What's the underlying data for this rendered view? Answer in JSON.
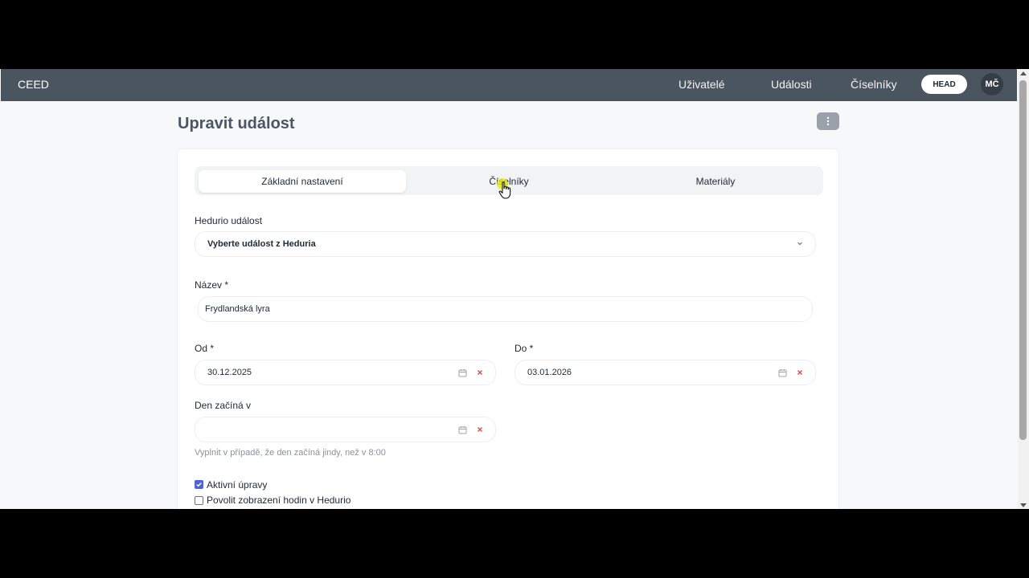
{
  "nav": {
    "brand": "CEED",
    "links": [
      "Uživatelé",
      "Události",
      "Číselníky"
    ],
    "head_badge": "HEAD",
    "avatar_initials": "MČ"
  },
  "page": {
    "title": "Upravit událost"
  },
  "tabs": [
    {
      "label": "Základní nastavení",
      "active": true
    },
    {
      "label": "Číselníky",
      "active": false
    },
    {
      "label": "Materiály",
      "active": false
    }
  ],
  "form": {
    "hedurio_label": "Hedurio událost",
    "hedurio_value": "Vyberte událost z Heduria",
    "name_label": "Název *",
    "name_value": "Frydlandská lyra",
    "from_label": "Od *",
    "from_value": "30.12.2025",
    "to_label": "Do *",
    "to_value": "03.01.2026",
    "day_start_label": "Den začíná v",
    "day_start_value": "",
    "day_start_hint": "Vyplnit v případě, že den začíná jindy, než v 8:00",
    "checkboxes": [
      {
        "label": "Aktivní úpravy",
        "checked": true
      },
      {
        "label": "Povolit zobrazení hodin v Hedurio",
        "checked": false
      }
    ]
  },
  "colors": {
    "navbar": "#4b5560",
    "accent": "#4f63d2",
    "clear_icon": "#d9534f"
  }
}
